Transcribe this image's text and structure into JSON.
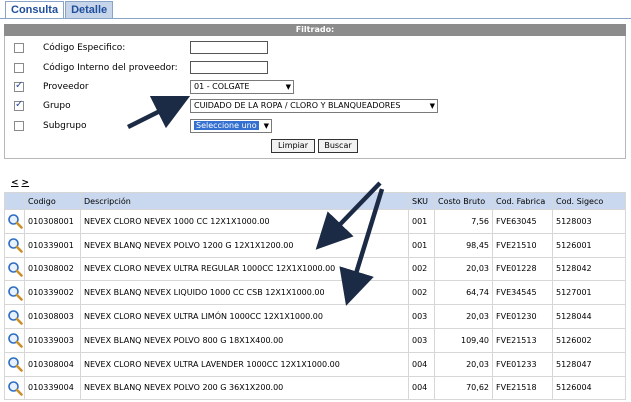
{
  "tabs": [
    {
      "label": "Consulta",
      "active": true
    },
    {
      "label": "Detalle",
      "active": false
    }
  ],
  "filter": {
    "header": "Filtrado:",
    "fields": [
      {
        "label": "Código Especifico:",
        "checked": false,
        "value": ""
      },
      {
        "label": "Código Interno del proveedor:",
        "checked": false,
        "value": ""
      },
      {
        "label": "Proveedor",
        "checked": true,
        "value": "01 - COLGATE"
      },
      {
        "label": "Grupo",
        "checked": true,
        "value": "CUIDADO DE LA ROPA / CLORO Y BLANQUEADORES"
      },
      {
        "label": "Subgrupo",
        "checked": false,
        "value": "Seleccione uno"
      }
    ],
    "buttons": {
      "clear": "Limpiar",
      "search": "Buscar"
    }
  },
  "nav": {
    "prev": "<",
    "next": ">"
  },
  "table": {
    "headers": [
      "",
      "Codigo",
      "Descripción",
      "SKU",
      "Costo Bruto",
      "Cod. Fabrica",
      "Cod. Sigeco"
    ],
    "rows": [
      [
        "010308001",
        "NEVEX CLORO NEVEX 1000 CC 12X1X1000.00",
        "001",
        "7,56",
        "FVE63045",
        "5128003"
      ],
      [
        "010339001",
        "NEVEX BLANQ NEVEX POLVO 1200 G 12X1X1200.00",
        "001",
        "98,45",
        "FVE21510",
        "5126001"
      ],
      [
        "010308002",
        "NEVEX CLORO NEVEX ULTRA REGULAR 1000CC 12X1X1000.00",
        "002",
        "20,03",
        "FVE01228",
        "5128042"
      ],
      [
        "010339002",
        "NEVEX BLANQ NEVEX LIQUIDO 1000 CC CSB 12X1X1000.00",
        "002",
        "64,74",
        "FVE34545",
        "5127001"
      ],
      [
        "010308003",
        "NEVEX CLORO NEVEX ULTRA LIMÓN 1000CC 12X1X1000.00",
        "003",
        "20,03",
        "FVE01230",
        "5128044"
      ],
      [
        "010339003",
        "NEVEX BLANQ NEVEX POLVO 800 G 18X1X400.00",
        "003",
        "109,40",
        "FVE21513",
        "5126002"
      ],
      [
        "010308004",
        "NEVEX CLORO NEVEX ULTRA LAVENDER 1000CC 12X1X1000.00",
        "004",
        "20,03",
        "FVE01233",
        "5128047"
      ],
      [
        "010339004",
        "NEVEX BLANQ NEVEX POLVO 200 G 36X1X200.00",
        "004",
        "70,62",
        "FVE21518",
        "5126004"
      ]
    ]
  },
  "colors": {
    "accent": "#1f4e9c",
    "header_bg": "#c9d8ee",
    "filter_bar": "#8c8c8c",
    "arrow": "#1b2a45"
  },
  "icons": {
    "row_action": "magnifier-icon",
    "checkbox_mark": "checkmark-icon",
    "dropdown": "chevron-down-icon"
  }
}
